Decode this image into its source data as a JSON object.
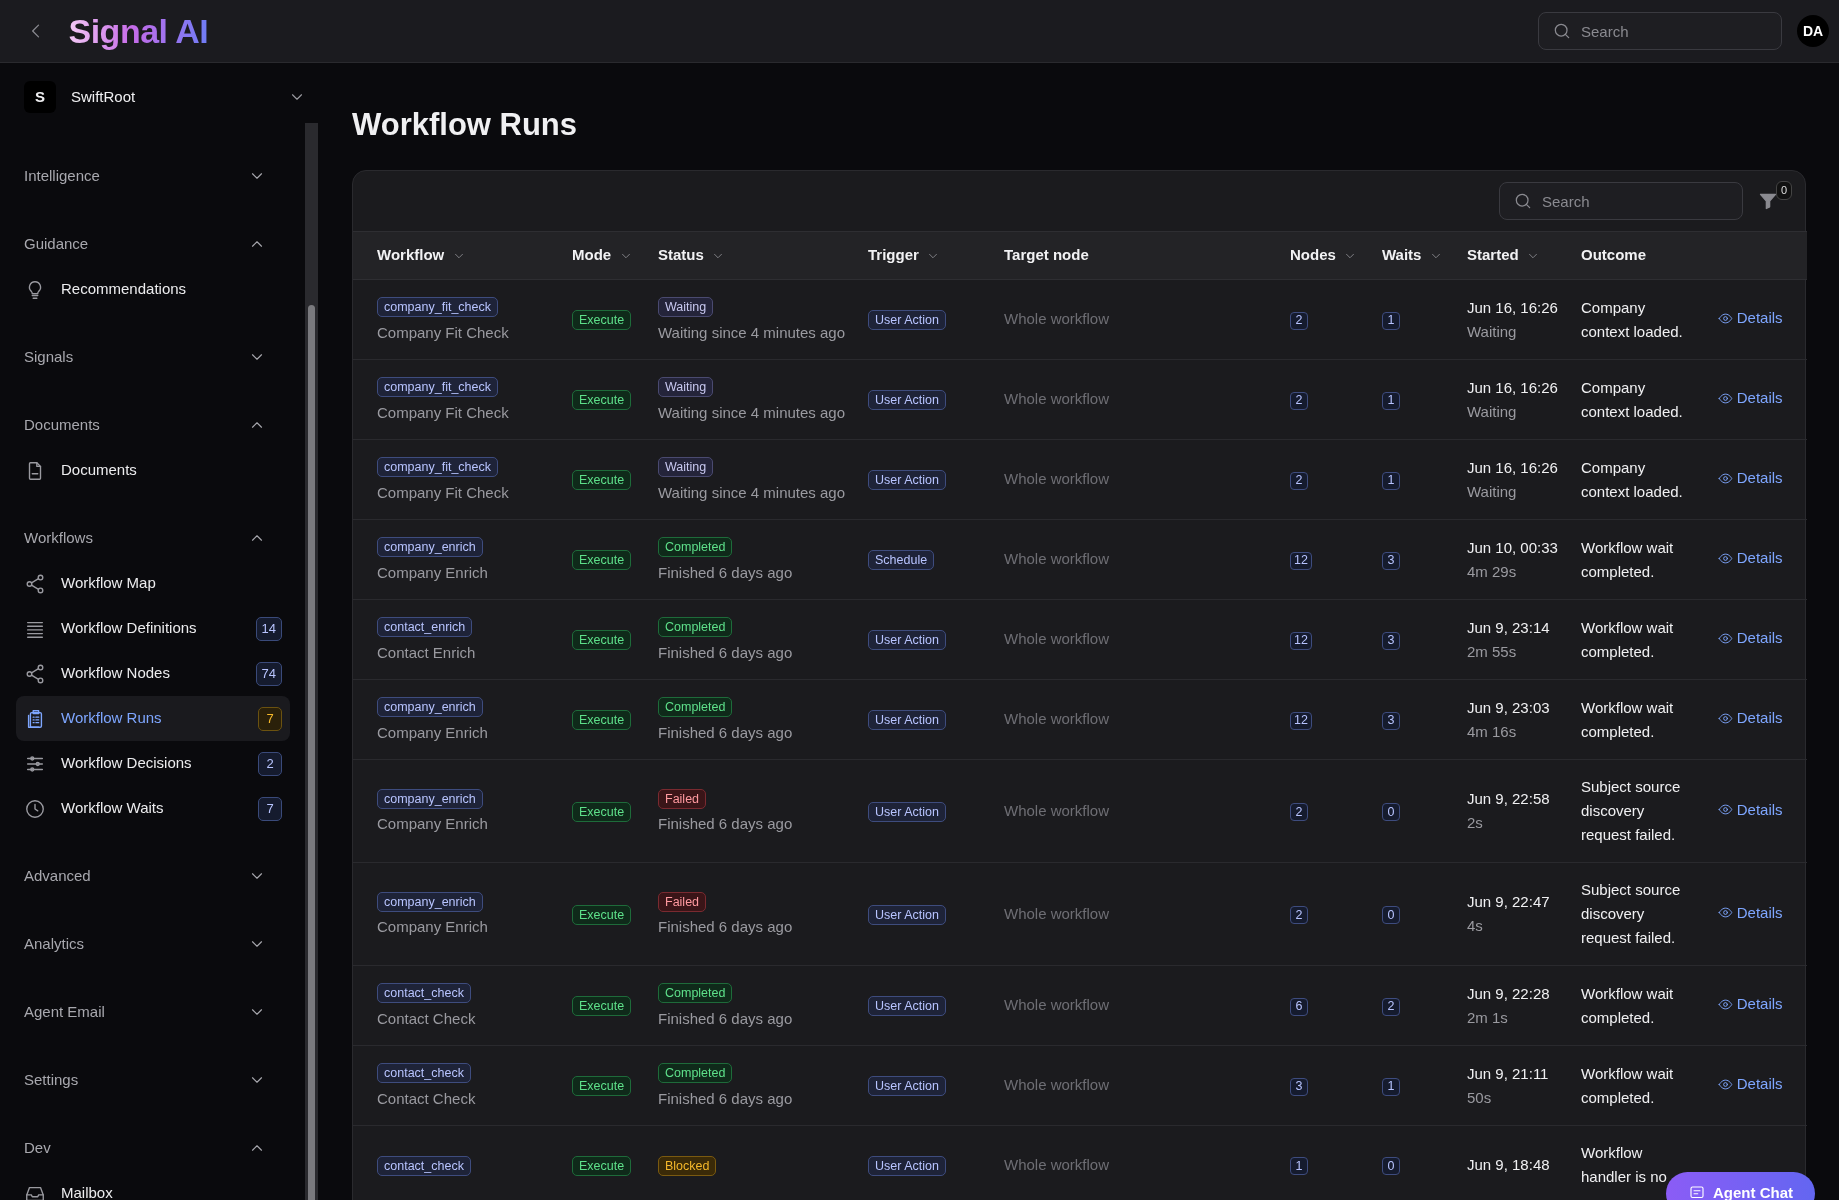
{
  "header": {
    "logo": "Signal AI",
    "search": {
      "placeholder": "Search"
    },
    "avatar": "DA"
  },
  "sidebar": {
    "team": {
      "initial": "S",
      "name": "SwiftRoot"
    },
    "sections": [
      {
        "title": "Intelligence",
        "expanded": false
      },
      {
        "title": "Guidance",
        "expanded": true,
        "items": [
          {
            "label": "Recommendations",
            "selected": false
          }
        ]
      },
      {
        "title": "Signals",
        "expanded": false
      },
      {
        "title": "Documents",
        "expanded": true,
        "items": [
          {
            "label": "Documents",
            "selected": false
          }
        ]
      },
      {
        "title": "Workflows",
        "expanded": true,
        "items": [
          {
            "label": "Workflow Map",
            "selected": false
          },
          {
            "label": "Workflow Definitions",
            "badge": "14",
            "selected": false
          },
          {
            "label": "Workflow Nodes",
            "badge": "74",
            "selected": false
          },
          {
            "label": "Workflow Runs",
            "badge": "7",
            "selected": true
          },
          {
            "label": "Workflow Decisions",
            "badge": "2",
            "selected": false
          },
          {
            "label": "Workflow Waits",
            "badge": "7",
            "selected": false
          }
        ]
      },
      {
        "title": "Advanced",
        "expanded": false
      },
      {
        "title": "Analytics",
        "expanded": false
      },
      {
        "title": "Agent Email",
        "expanded": false
      },
      {
        "title": "Settings",
        "expanded": false
      },
      {
        "title": "Dev",
        "expanded": true,
        "items": [
          {
            "label": "Mailbox",
            "selected": false
          }
        ]
      }
    ]
  },
  "page": {
    "title": "Workflow Runs"
  },
  "toolbar": {
    "search": {
      "placeholder": "Search"
    },
    "filter_count": "0"
  },
  "table": {
    "columns": [
      {
        "label": "Workflow",
        "sortable": true
      },
      {
        "label": "Mode",
        "sortable": true
      },
      {
        "label": "Status",
        "sortable": true
      },
      {
        "label": "Trigger",
        "sortable": true
      },
      {
        "label": "Target node",
        "sortable": false
      },
      {
        "label": "Nodes",
        "sortable": true
      },
      {
        "label": "Waits",
        "sortable": true
      },
      {
        "label": "Started",
        "sortable": true
      },
      {
        "label": "Outcome",
        "sortable": false
      }
    ],
    "rows": [
      {
        "key": "company_fit_check",
        "name": "Company Fit Check",
        "mode": "Execute",
        "status": {
          "kind": "waiting",
          "label": "Waiting",
          "note": "Waiting since 4 minutes ago"
        },
        "trigger": "User Action",
        "target": "Whole workflow",
        "nodes": "2",
        "waits": "1",
        "started": "Jun 16, 16:26",
        "duration": "Waiting",
        "outcome": "Company context loaded.",
        "action": "Details"
      },
      {
        "key": "company_fit_check",
        "name": "Company Fit Check",
        "mode": "Execute",
        "status": {
          "kind": "waiting",
          "label": "Waiting",
          "note": "Waiting since 4 minutes ago"
        },
        "trigger": "User Action",
        "target": "Whole workflow",
        "nodes": "2",
        "waits": "1",
        "started": "Jun 16, 16:26",
        "duration": "Waiting",
        "outcome": "Company context loaded.",
        "action": "Details"
      },
      {
        "key": "company_fit_check",
        "name": "Company Fit Check",
        "mode": "Execute",
        "status": {
          "kind": "waiting",
          "label": "Waiting",
          "note": "Waiting since 4 minutes ago"
        },
        "trigger": "User Action",
        "target": "Whole workflow",
        "nodes": "2",
        "waits": "1",
        "started": "Jun 16, 16:26",
        "duration": "Waiting",
        "outcome": "Company context loaded.",
        "action": "Details"
      },
      {
        "key": "company_enrich",
        "name": "Company Enrich",
        "mode": "Execute",
        "status": {
          "kind": "completed",
          "label": "Completed",
          "note": "Finished 6 days ago"
        },
        "trigger": "Schedule",
        "target": "Whole workflow",
        "nodes": "12",
        "waits": "3",
        "started": "Jun 10, 00:33",
        "duration": "4m 29s",
        "outcome": "Workflow wait completed.",
        "action": "Details"
      },
      {
        "key": "contact_enrich",
        "name": "Contact Enrich",
        "mode": "Execute",
        "status": {
          "kind": "completed",
          "label": "Completed",
          "note": "Finished 6 days ago"
        },
        "trigger": "User Action",
        "target": "Whole workflow",
        "nodes": "12",
        "waits": "3",
        "started": "Jun 9, 23:14",
        "duration": "2m 55s",
        "outcome": "Workflow wait completed.",
        "action": "Details"
      },
      {
        "key": "company_enrich",
        "name": "Company Enrich",
        "mode": "Execute",
        "status": {
          "kind": "completed",
          "label": "Completed",
          "note": "Finished 6 days ago"
        },
        "trigger": "User Action",
        "target": "Whole workflow",
        "nodes": "12",
        "waits": "3",
        "started": "Jun 9, 23:03",
        "duration": "4m 16s",
        "outcome": "Workflow wait completed.",
        "action": "Details"
      },
      {
        "key": "company_enrich",
        "name": "Company Enrich",
        "mode": "Execute",
        "status": {
          "kind": "failed",
          "label": "Failed",
          "note": "Finished 6 days ago"
        },
        "trigger": "User Action",
        "target": "Whole workflow",
        "nodes": "2",
        "waits": "0",
        "started": "Jun 9, 22:58",
        "duration": "2s",
        "outcome": "Subject source discovery request failed.",
        "action": "Details"
      },
      {
        "key": "company_enrich",
        "name": "Company Enrich",
        "mode": "Execute",
        "status": {
          "kind": "failed",
          "label": "Failed",
          "note": "Finished 6 days ago"
        },
        "trigger": "User Action",
        "target": "Whole workflow",
        "nodes": "2",
        "waits": "0",
        "started": "Jun 9, 22:47",
        "duration": "4s",
        "outcome": "Subject source discovery request failed.",
        "action": "Details"
      },
      {
        "key": "contact_check",
        "name": "Contact Check",
        "mode": "Execute",
        "status": {
          "kind": "completed",
          "label": "Completed",
          "note": "Finished 6 days ago"
        },
        "trigger": "User Action",
        "target": "Whole workflow",
        "nodes": "6",
        "waits": "2",
        "started": "Jun 9, 22:28",
        "duration": "2m 1s",
        "outcome": "Workflow wait completed.",
        "action": "Details"
      },
      {
        "key": "contact_check",
        "name": "Contact Check",
        "mode": "Execute",
        "status": {
          "kind": "completed",
          "label": "Completed",
          "note": "Finished 6 days ago"
        },
        "trigger": "User Action",
        "target": "Whole workflow",
        "nodes": "3",
        "waits": "1",
        "started": "Jun 9, 21:11",
        "duration": "50s",
        "outcome": "Workflow wait completed.",
        "action": "Details"
      },
      {
        "key": "contact_check",
        "mode": "Execute",
        "status": {
          "kind": "blocked",
          "label": "Blocked"
        },
        "trigger": "User Action",
        "target": "Whole workflow",
        "nodes": "1",
        "waits": "0",
        "started": "Jun 9, 18:48",
        "outcome": "Workflow handler is no"
      }
    ]
  },
  "agent_chat": {
    "label": "Agent Chat"
  }
}
